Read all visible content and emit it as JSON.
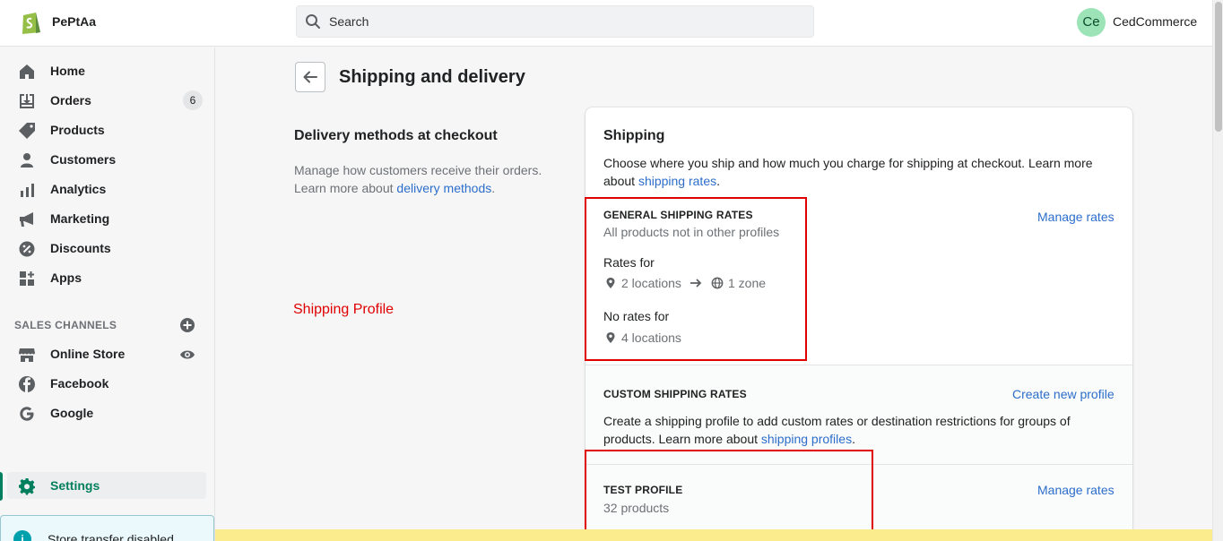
{
  "header": {
    "store_name": "PePtAa",
    "search_placeholder": "Search",
    "avatar_initials": "Ce",
    "user_name": "CedCommerce"
  },
  "sidebar": {
    "items": [
      {
        "label": "Home",
        "icon": "home-icon"
      },
      {
        "label": "Orders",
        "icon": "orders-icon",
        "badge": "6"
      },
      {
        "label": "Products",
        "icon": "tag-icon"
      },
      {
        "label": "Customers",
        "icon": "person-icon"
      },
      {
        "label": "Analytics",
        "icon": "bar-chart-icon"
      },
      {
        "label": "Marketing",
        "icon": "megaphone-icon"
      },
      {
        "label": "Discounts",
        "icon": "discount-icon"
      },
      {
        "label": "Apps",
        "icon": "apps-icon"
      }
    ],
    "sales_channels_title": "SALES CHANNELS",
    "channels": [
      {
        "label": "Online Store",
        "icon": "store-icon"
      },
      {
        "label": "Facebook",
        "icon": "facebook-icon"
      },
      {
        "label": "Google",
        "icon": "google-icon"
      }
    ],
    "settings_label": "Settings",
    "transfer_notice": "Store transfer disabled"
  },
  "page": {
    "title": "Shipping and delivery",
    "section_heading": "Delivery methods at checkout",
    "section_desc_1": "Manage how customers receive their orders.",
    "section_desc_2": "Learn more about",
    "section_link": "delivery methods",
    "annotation": "Shipping Profile"
  },
  "shipping_card": {
    "title": "Shipping",
    "desc": "Choose where you ship and how much you charge for shipping at checkout. Learn more about",
    "desc_link": "shipping rates",
    "general": {
      "heading": "GENERAL SHIPPING RATES",
      "subtitle": "All products not in other profiles",
      "manage": "Manage rates",
      "rates_for": "Rates for",
      "locations": "2 locations",
      "zones": "1 zone",
      "no_rates_for": "No rates for",
      "no_rate_locations": "4 locations"
    },
    "custom": {
      "heading": "CUSTOM SHIPPING RATES",
      "create": "Create new profile",
      "desc": "Create a shipping profile to add custom rates or destination restrictions for groups of products. Learn more about",
      "desc_link": "shipping profiles"
    },
    "test_profile": {
      "heading": "TEST PROFILE",
      "products": "32 products",
      "manage": "Manage rates"
    }
  },
  "colors": {
    "accent_green": "#008060",
    "link_blue": "#2c6ecb",
    "annotation_red": "#e00000",
    "banner_yellow": "#fbed8e"
  }
}
